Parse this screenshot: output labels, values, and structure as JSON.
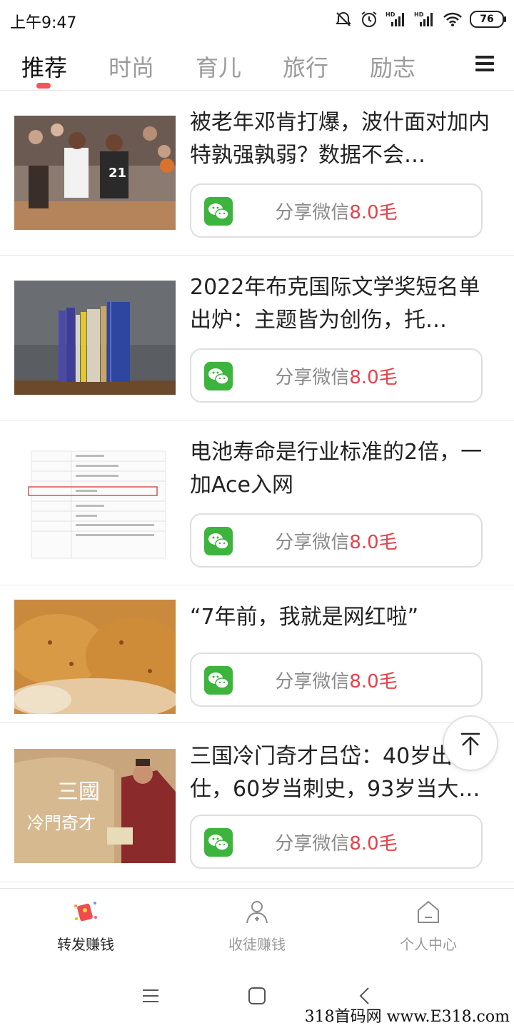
{
  "status": {
    "time": "上午9:47",
    "battery": "76",
    "signal1": "HD",
    "signal2": "HD"
  },
  "tabs": [
    {
      "label": "推荐"
    },
    {
      "label": "时尚"
    },
    {
      "label": "育儿"
    },
    {
      "label": "旅行"
    },
    {
      "label": "励志"
    }
  ],
  "articles": [
    {
      "title": "被老年邓肯打爆，波什面对加内特孰强孰弱？数据不会…",
      "share_label": "分享微信",
      "share_amount": "8.0毛"
    },
    {
      "title": "2022年布克国际文学奖短名单出炉：主题皆为创伤，托…",
      "share_label": "分享微信",
      "share_amount": "8.0毛"
    },
    {
      "title": "电池寿命是行业标准的2倍，一加Ace入网",
      "share_label": "分享微信",
      "share_amount": "8.0毛"
    },
    {
      "title": "“7年前，我就是网红啦”",
      "share_label": "分享微信",
      "share_amount": "8.0毛"
    },
    {
      "title": "三国冷门奇才吕岱：40岁出仕，60岁当刺史，93岁当大…",
      "share_label": "分享微信",
      "share_amount": "8.0毛",
      "thumb_text_1": "三國",
      "thumb_text_2": "冷門奇才"
    }
  ],
  "bottom_nav": [
    {
      "label": "转发赚钱"
    },
    {
      "label": "收徒赚钱"
    },
    {
      "label": "个人中心"
    }
  ],
  "watermark": "318首码网 www.E318.com",
  "colors": {
    "accent": "#f4545b",
    "amount": "#e8404a",
    "wechat": "#3cb43d"
  }
}
